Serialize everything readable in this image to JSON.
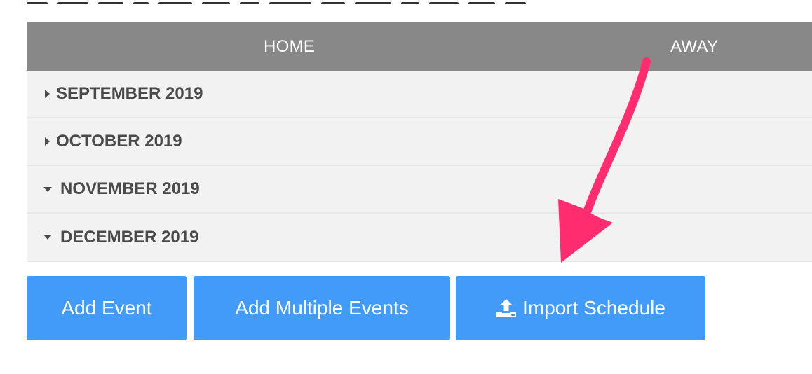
{
  "header": {
    "home_label": "HOME",
    "away_label": "AWAY"
  },
  "months": [
    {
      "label": "SEPTEMBER 2019",
      "expanded": false
    },
    {
      "label": "OCTOBER 2019",
      "expanded": false
    },
    {
      "label": "NOVEMBER 2019",
      "expanded": true
    },
    {
      "label": "DECEMBER 2019",
      "expanded": true
    }
  ],
  "actions": {
    "add_event": "Add Event",
    "add_multiple": "Add Multiple Events",
    "import_schedule": "Import Schedule",
    "import_icon": "upload-icon"
  },
  "colors": {
    "header_bg": "#888888",
    "row_bg": "#f2f2f2",
    "button_bg": "#429bf8",
    "annotation_arrow": "#ff2d6f"
  }
}
